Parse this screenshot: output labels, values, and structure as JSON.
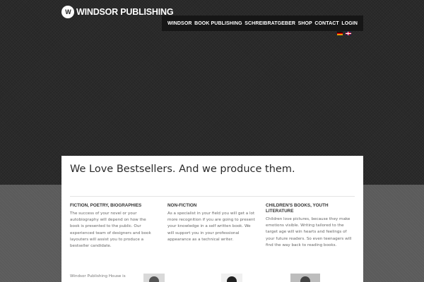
{
  "brand": {
    "logo_mark": "W",
    "name": "WINDSOR PUBLISHING"
  },
  "nav": {
    "items": [
      "WINDSOR",
      "BOOK PUBLISHING",
      "SCHREIBRATGEBER",
      "SHOP",
      "CONTACT",
      "LOGIN"
    ]
  },
  "languages": [
    {
      "icon": "german-flag-icon"
    },
    {
      "icon": "uk-flag-icon"
    }
  ],
  "main": {
    "headline": "We Love Bestsellers. And we produce them.",
    "columns": [
      {
        "title": "FICTION, POETRY, BIOGRAPHIES",
        "text": "The success of your novel or your autobiography will depend on how the book is presented to the public. Our experienced team of designers and book layouters will assist you to produce a bestseller candidate."
      },
      {
        "title": "NON-FICTION",
        "text": "As a specialist in your field you will get a lot more recognition if you are going to present your knowledge in a self written book. We will support you in your professional appearance as a technical writer."
      },
      {
        "title": "CHILDREN'S BOOKS, YOUTH LITERATURE",
        "text": "Children love pictures, because they make emotions visible. Writing tailored to the target age will win hearts and feelings of your future readers. So even teenagers will find the way back to reading books."
      }
    ],
    "intro": "Windsor Publishing House is"
  },
  "colors": {
    "hero_bg": "#2a2a2a",
    "nav_bg": "#161616",
    "panel_bg": "#ffffff",
    "lower_bg": "#5b5b5b"
  }
}
